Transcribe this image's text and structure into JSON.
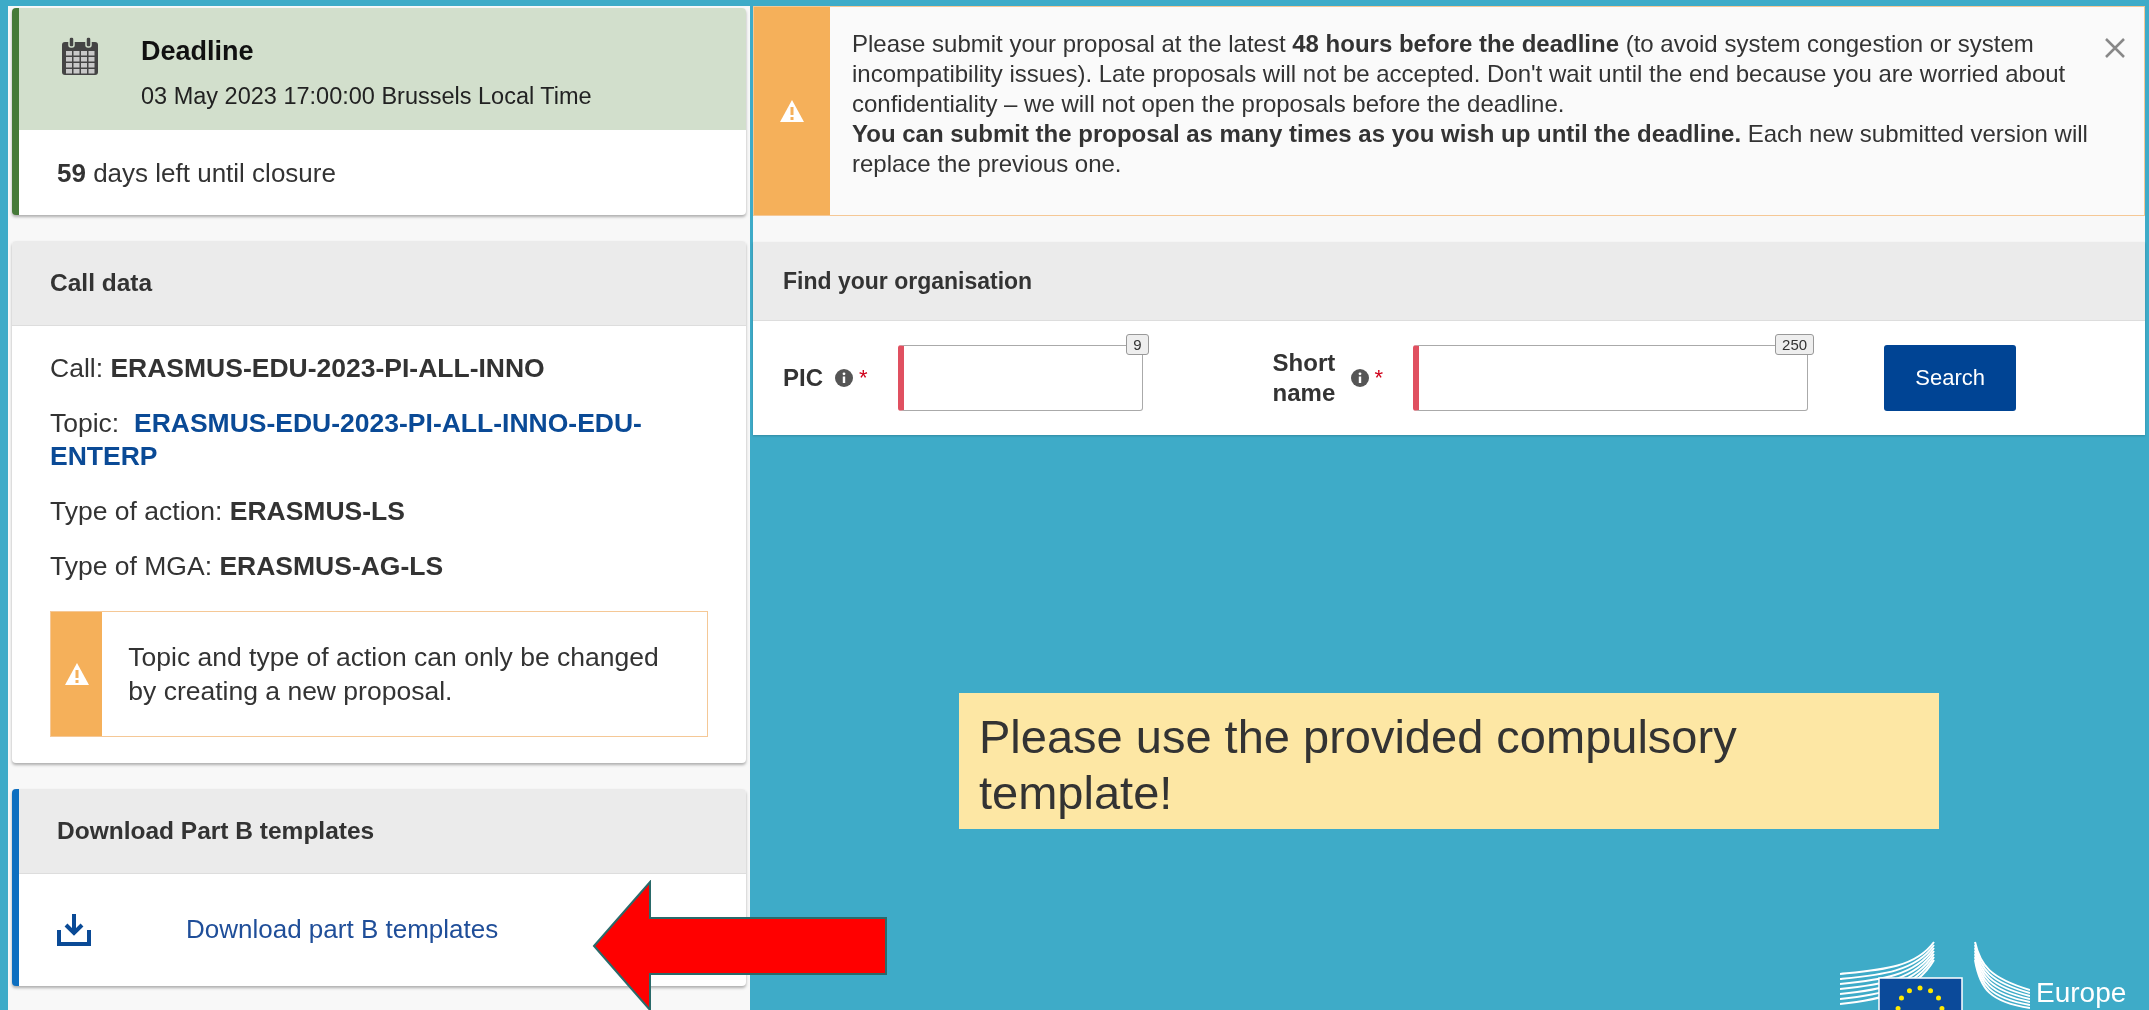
{
  "deadline": {
    "title": "Deadline",
    "date": "03 May 2023 17:00:00 Brussels Local Time",
    "remaining": "**59** days left until closure"
  },
  "call_data": {
    "title": "Call data",
    "fields": [
      {
        "label": "Call:",
        "value": "ERASMUS-EDU-2023-PI-ALL-INNO",
        "kind": "text"
      },
      {
        "label": "Topic:",
        "value": "ERASMUS-EDU-2023-PI-ALL-INNO-EDU-ENTERP",
        "kind": "link"
      },
      {
        "label": "Type of action:",
        "value": "ERASMUS-LS",
        "kind": "text"
      },
      {
        "label": "Type of MGA:",
        "value": "ERASMUS-AG-LS",
        "kind": "text"
      }
    ],
    "warning": "Topic and type of action can only be changed by creating a new proposal."
  },
  "download": {
    "title": "Download Part B templates",
    "link": "Download part B templates"
  },
  "alert": {
    "paragraphs": [
      "Please submit your proposal at the latest **48 hours before the deadline** (to avoid system congestion or system incompatibility issues). Late proposals will not be accepted. Don't wait until the end because you are worried about confidentiality – we will not open the proposals before the deadline.",
      "**You can submit the proposal as many times as you wish up until the deadline.** Each new submitted version will replace the previous one."
    ]
  },
  "find_org": {
    "title": "Find your organisation",
    "fields": [
      {
        "label": "PIC",
        "max": "9",
        "required": true,
        "required_mark": "*",
        "kind": "short"
      },
      {
        "label": "Short name",
        "max": "250",
        "required": true,
        "required_mark": "*",
        "kind": "long"
      }
    ],
    "button": "Search"
  },
  "note": "Please use the provided compulsory template!",
  "logo": {
    "text": "Europe"
  }
}
